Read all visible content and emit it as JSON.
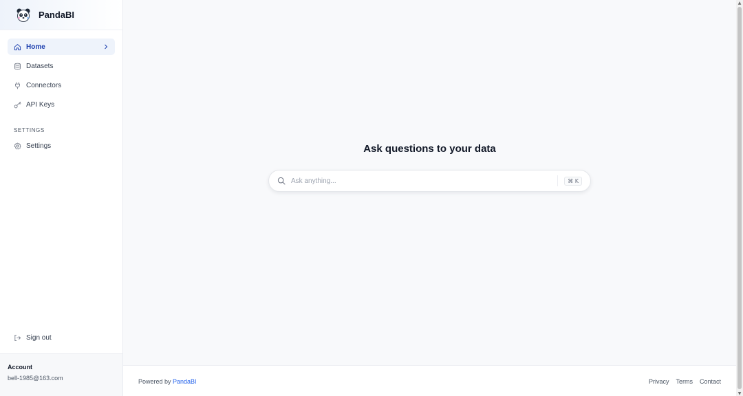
{
  "brand": {
    "name": "PandaBI",
    "logo_icon": "panda-logo-icon"
  },
  "nav": {
    "items": [
      {
        "label": "Home",
        "icon": "home-icon",
        "active": true
      },
      {
        "label": "Datasets",
        "icon": "database-icon"
      },
      {
        "label": "Connectors",
        "icon": "plug-icon"
      },
      {
        "label": "API Keys",
        "icon": "key-icon"
      }
    ],
    "settings_section": "SETTINGS",
    "settings_item": {
      "label": "Settings",
      "icon": "gear-icon"
    },
    "signout": {
      "label": "Sign out",
      "icon": "sign-out-icon"
    }
  },
  "account": {
    "title": "Account",
    "email": "bell-1985@163.com"
  },
  "main": {
    "title": "Ask questions to your data",
    "search": {
      "placeholder": "Ask anything...",
      "shortcut": "⌘ K"
    }
  },
  "footer": {
    "powered_prefix": "Powered by ",
    "powered_link": "PandaBI",
    "links": [
      "Privacy",
      "Terms",
      "Contact"
    ]
  },
  "colors": {
    "accent": "#2563eb",
    "active_bg": "#eef3fb",
    "page_bg": "#f8f9fb"
  }
}
